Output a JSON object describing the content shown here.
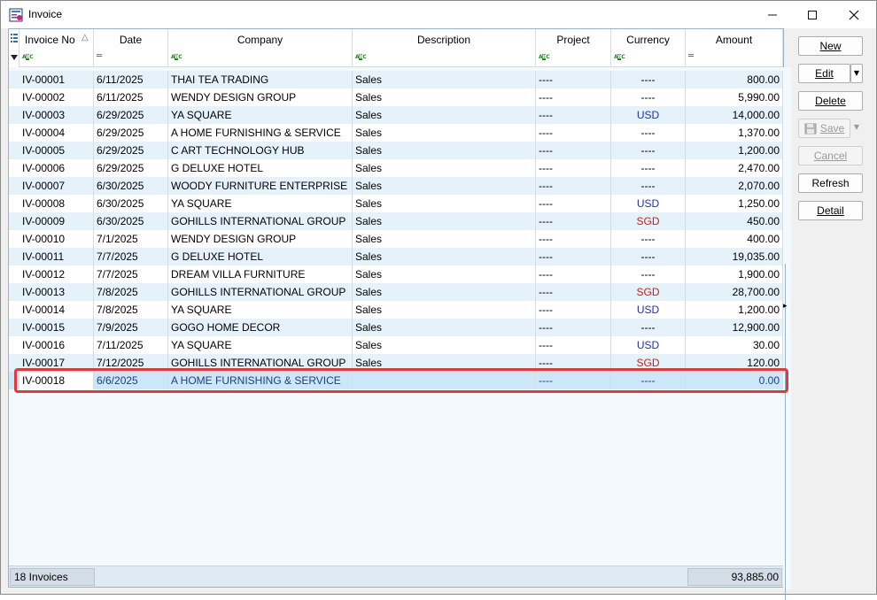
{
  "window": {
    "title": "Invoice",
    "minimize": "—",
    "maximize": "☐",
    "close": "✕"
  },
  "grid": {
    "columns": [
      {
        "key": "no",
        "label": "Invoice No",
        "sort": "△",
        "filter": "abc"
      },
      {
        "key": "date",
        "label": "Date",
        "filter": "eq"
      },
      {
        "key": "company",
        "label": "Company",
        "filter": "abc"
      },
      {
        "key": "desc",
        "label": "Description",
        "filter": "abc"
      },
      {
        "key": "project",
        "label": "Project",
        "filter": "abc"
      },
      {
        "key": "currency",
        "label": "Currency",
        "filter": "abc"
      },
      {
        "key": "amount",
        "label": "Amount",
        "filter": "eq"
      }
    ],
    "filter_abc_text": "ABC",
    "filter_eq_text": "═",
    "rows": [
      {
        "no": "IV-00001",
        "date": "6/11/2025",
        "company": "THAI TEA TRADING",
        "desc": "Sales",
        "project": "----",
        "currency": "----",
        "amount": "800.00"
      },
      {
        "no": "IV-00002",
        "date": "6/11/2025",
        "company": "WENDY DESIGN GROUP",
        "desc": "Sales",
        "project": "----",
        "currency": "----",
        "amount": "5,990.00"
      },
      {
        "no": "IV-00003",
        "date": "6/29/2025",
        "company": "YA SQUARE",
        "desc": "Sales",
        "project": "----",
        "currency": "USD",
        "amount": "14,000.00"
      },
      {
        "no": "IV-00004",
        "date": "6/29/2025",
        "company": "A HOME FURNISHING & SERVICE",
        "desc": "Sales",
        "project": "----",
        "currency": "----",
        "amount": "1,370.00"
      },
      {
        "no": "IV-00005",
        "date": "6/29/2025",
        "company": "C ART TECHNOLOGY HUB",
        "desc": "Sales",
        "project": "----",
        "currency": "----",
        "amount": "1,200.00"
      },
      {
        "no": "IV-00006",
        "date": "6/29/2025",
        "company": "G DELUXE HOTEL",
        "desc": "Sales",
        "project": "----",
        "currency": "----",
        "amount": "2,470.00"
      },
      {
        "no": "IV-00007",
        "date": "6/30/2025",
        "company": "WOODY FURNITURE ENTERPRISE",
        "desc": "Sales",
        "project": "----",
        "currency": "----",
        "amount": "2,070.00"
      },
      {
        "no": "IV-00008",
        "date": "6/30/2025",
        "company": "YA SQUARE",
        "desc": "Sales",
        "project": "----",
        "currency": "USD",
        "amount": "1,250.00"
      },
      {
        "no": "IV-00009",
        "date": "6/30/2025",
        "company": "GOHILLS INTERNATIONAL GROUP",
        "desc": "Sales",
        "project": "----",
        "currency": "SGD",
        "amount": "450.00"
      },
      {
        "no": "IV-00010",
        "date": "7/1/2025",
        "company": "WENDY DESIGN GROUP",
        "desc": "Sales",
        "project": "----",
        "currency": "----",
        "amount": "400.00"
      },
      {
        "no": "IV-00011",
        "date": "7/7/2025",
        "company": "G DELUXE HOTEL",
        "desc": "Sales",
        "project": "----",
        "currency": "----",
        "amount": "19,035.00"
      },
      {
        "no": "IV-00012",
        "date": "7/7/2025",
        "company": "DREAM VILLA FURNITURE",
        "desc": "Sales",
        "project": "----",
        "currency": "----",
        "amount": "1,900.00"
      },
      {
        "no": "IV-00013",
        "date": "7/8/2025",
        "company": "GOHILLS INTERNATIONAL GROUP",
        "desc": "Sales",
        "project": "----",
        "currency": "SGD",
        "amount": "28,700.00"
      },
      {
        "no": "IV-00014",
        "date": "7/8/2025",
        "company": "YA SQUARE",
        "desc": "Sales",
        "project": "----",
        "currency": "USD",
        "amount": "1,200.00"
      },
      {
        "no": "IV-00015",
        "date": "7/9/2025",
        "company": "GOGO HOME DECOR",
        "desc": "Sales",
        "project": "----",
        "currency": "----",
        "amount": "12,900.00"
      },
      {
        "no": "IV-00016",
        "date": "7/11/2025",
        "company": "YA SQUARE",
        "desc": "Sales",
        "project": "----",
        "currency": "USD",
        "amount": "30.00"
      },
      {
        "no": "IV-00017",
        "date": "7/12/2025",
        "company": "GOHILLS INTERNATIONAL GROUP",
        "desc": "Sales",
        "project": "----",
        "currency": "SGD",
        "amount": "120.00"
      },
      {
        "no": "IV-00018",
        "date": "6/6/2025",
        "company": "A HOME FURNISHING & SERVICE",
        "desc": "",
        "project": "----",
        "currency": "----",
        "amount": "0.00",
        "selected": true
      }
    ]
  },
  "footer": {
    "count": "18 Invoices",
    "total": "93,885.00"
  },
  "buttons": {
    "new": "New",
    "edit": "Edit",
    "delete": "Delete",
    "save": "Save",
    "cancel": "Cancel",
    "refresh": "Refresh",
    "detail": "Detail"
  },
  "colors": {
    "usd": "#1f2fb0",
    "sgd": "#d11a1a",
    "highlight": "#e23a3a"
  }
}
